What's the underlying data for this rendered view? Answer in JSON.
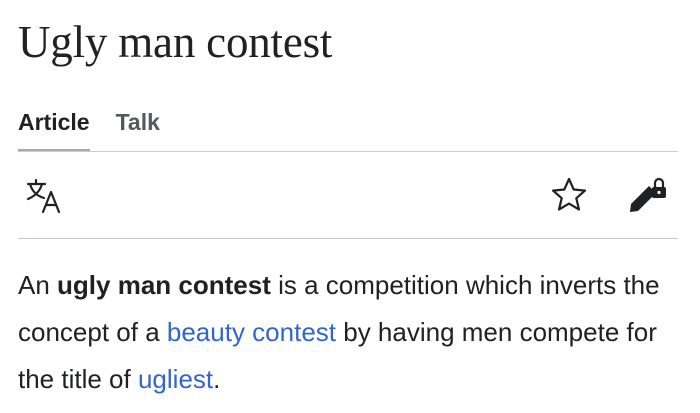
{
  "page": {
    "title": "Ugly man contest"
  },
  "tabs": [
    {
      "label": "Article",
      "active": true
    },
    {
      "label": "Talk",
      "active": false
    }
  ],
  "toolbar": {
    "language_icon": "translate-icon",
    "watch_icon": "star-icon",
    "edit_icon": "pencil-lock-icon"
  },
  "article": {
    "lede": {
      "intro": "An ",
      "bold_term": "ugly man contest",
      "text_1": " is a competition which inverts the concept of a ",
      "link_1": "beauty contest",
      "text_2": " by having men compete for the title of ",
      "link_2": "ugliest",
      "text_3": "."
    }
  },
  "colors": {
    "text": "#202122",
    "link": "#3366cc",
    "divider": "#c8ccd1",
    "tab_underline": "#a2a9b1"
  }
}
